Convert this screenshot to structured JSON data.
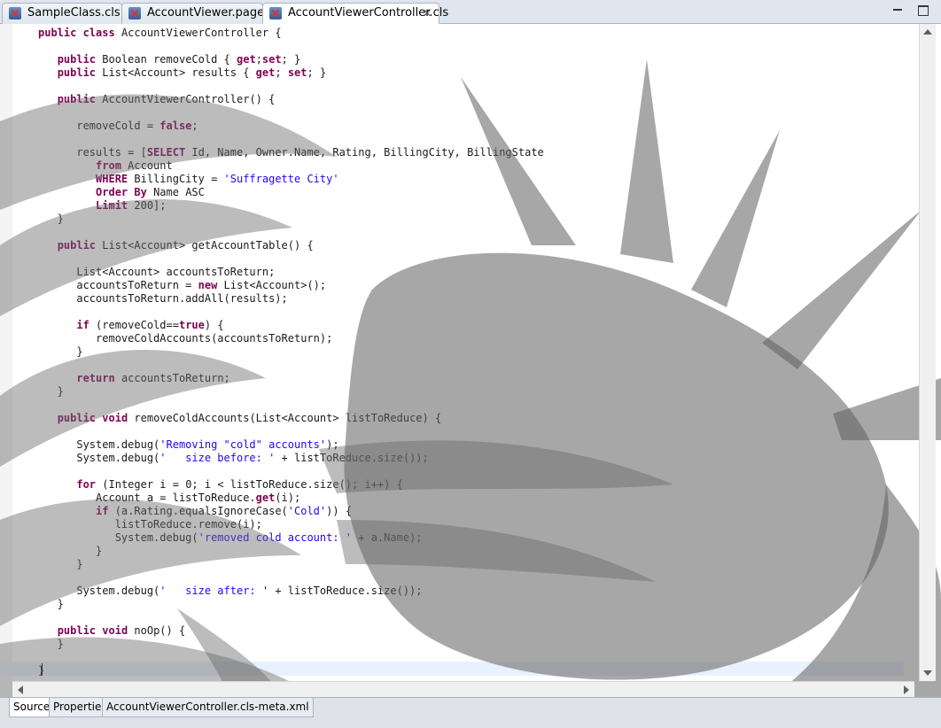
{
  "tabs": [
    {
      "label": "SampleClass.cls",
      "icon": "apex-class-icon"
    },
    {
      "label": "AccountViewer.page",
      "icon": "apex-page-icon"
    },
    {
      "label": "AccountViewerController.cls",
      "icon": "apex-class-icon",
      "close": "✕"
    }
  ],
  "code_lines": [
    "public class AccountViewerController {",
    "",
    "   public Boolean removeCold { get;set; }",
    "   public List<Account> results { get; set; }",
    "",
    "   public AccountViewerController() {",
    "",
    "      removeCold = false;",
    "",
    "      results = [SELECT Id, Name, Owner.Name, Rating, BillingCity, BillingState",
    "         from Account",
    "         WHERE BillingCity = 'Suffragette City'",
    "         Order By Name ASC",
    "         Limit 200];",
    "   }",
    "",
    "   public List<Account> getAccountTable() {",
    "",
    "      List<Account> accountsToReturn;",
    "      accountsToReturn = new List<Account>();",
    "      accountsToReturn.addAll(results);",
    "",
    "      if (removeCold==true) {",
    "         removeColdAccounts(accountsToReturn);",
    "      }",
    "",
    "      return accountsToReturn;",
    "   }",
    "",
    "   public void removeColdAccounts(List<Account> listToReduce) {",
    "",
    "      System.debug('Removing \"cold\" accounts');",
    "      System.debug('   size before: ' + listToReduce.size());",
    "",
    "      for (Integer i = 0; i < listToReduce.size(); i++) {",
    "         Account a = listToReduce.get(i);",
    "         if (a.Rating.equalsIgnoreCase('Cold')) {",
    "            listToReduce.remove(i);",
    "            System.debug('removed cold account: ' + a.Name);",
    "         }",
    "      }",
    "",
    "      System.debug('   size after: ' + listToReduce.size());",
    "   }",
    "",
    "   public void noOp() {",
    "   }",
    "",
    "}"
  ],
  "bottom_tabs": [
    "Source",
    "Properties",
    "AccountViewerController.cls-meta.xml"
  ],
  "colors": {
    "keyword": "#7f0055",
    "string": "#2a00ff",
    "tab_bar": "#dfe6ef"
  }
}
